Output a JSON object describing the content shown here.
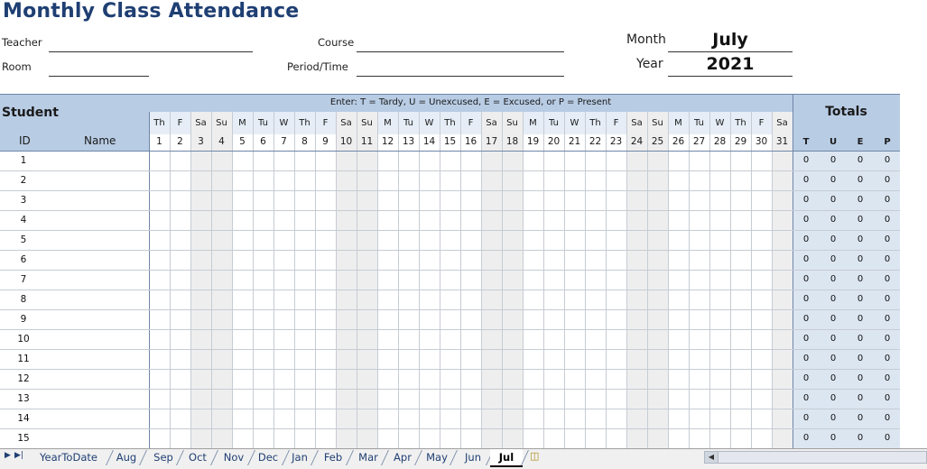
{
  "title": "Monthly Class Attendance",
  "form": {
    "teacher_label": "Teacher",
    "room_label": "Room",
    "course_label": "Course",
    "period_label": "Period/Time",
    "month_label": "Month",
    "month_value": "July",
    "year_label": "Year",
    "year_value": "2021"
  },
  "grid": {
    "student_header": "Student",
    "id_header": "ID",
    "name_header": "Name",
    "instructions": "Enter: T = Tardy,  U = Unexcused,  E = Excused,  or P = Present",
    "totals_header": "Totals",
    "totals_cols": [
      "T",
      "U",
      "E",
      "P"
    ],
    "days": [
      {
        "dow": "Th",
        "date": "1",
        "weekend": false
      },
      {
        "dow": "F",
        "date": "2",
        "weekend": false
      },
      {
        "dow": "Sa",
        "date": "3",
        "weekend": true
      },
      {
        "dow": "Su",
        "date": "4",
        "weekend": true
      },
      {
        "dow": "M",
        "date": "5",
        "weekend": false
      },
      {
        "dow": "Tu",
        "date": "6",
        "weekend": false
      },
      {
        "dow": "W",
        "date": "7",
        "weekend": false
      },
      {
        "dow": "Th",
        "date": "8",
        "weekend": false
      },
      {
        "dow": "F",
        "date": "9",
        "weekend": false
      },
      {
        "dow": "Sa",
        "date": "10",
        "weekend": true
      },
      {
        "dow": "Su",
        "date": "11",
        "weekend": true
      },
      {
        "dow": "M",
        "date": "12",
        "weekend": false
      },
      {
        "dow": "Tu",
        "date": "13",
        "weekend": false
      },
      {
        "dow": "W",
        "date": "14",
        "weekend": false
      },
      {
        "dow": "Th",
        "date": "15",
        "weekend": false
      },
      {
        "dow": "F",
        "date": "16",
        "weekend": false
      },
      {
        "dow": "Sa",
        "date": "17",
        "weekend": true
      },
      {
        "dow": "Su",
        "date": "18",
        "weekend": true
      },
      {
        "dow": "M",
        "date": "19",
        "weekend": false
      },
      {
        "dow": "Tu",
        "date": "20",
        "weekend": false
      },
      {
        "dow": "W",
        "date": "21",
        "weekend": false
      },
      {
        "dow": "Th",
        "date": "22",
        "weekend": false
      },
      {
        "dow": "F",
        "date": "23",
        "weekend": false
      },
      {
        "dow": "Sa",
        "date": "24",
        "weekend": true
      },
      {
        "dow": "Su",
        "date": "25",
        "weekend": true
      },
      {
        "dow": "M",
        "date": "26",
        "weekend": false
      },
      {
        "dow": "Tu",
        "date": "27",
        "weekend": false
      },
      {
        "dow": "W",
        "date": "28",
        "weekend": false
      },
      {
        "dow": "Th",
        "date": "29",
        "weekend": false
      },
      {
        "dow": "F",
        "date": "30",
        "weekend": false
      },
      {
        "dow": "Sa",
        "date": "31",
        "weekend": true
      }
    ],
    "rows": [
      {
        "id": "1",
        "totals": [
          "0",
          "0",
          "0",
          "0"
        ]
      },
      {
        "id": "2",
        "totals": [
          "0",
          "0",
          "0",
          "0"
        ]
      },
      {
        "id": "3",
        "totals": [
          "0",
          "0",
          "0",
          "0"
        ]
      },
      {
        "id": "4",
        "totals": [
          "0",
          "0",
          "0",
          "0"
        ]
      },
      {
        "id": "5",
        "totals": [
          "0",
          "0",
          "0",
          "0"
        ]
      },
      {
        "id": "6",
        "totals": [
          "0",
          "0",
          "0",
          "0"
        ]
      },
      {
        "id": "7",
        "totals": [
          "0",
          "0",
          "0",
          "0"
        ]
      },
      {
        "id": "8",
        "totals": [
          "0",
          "0",
          "0",
          "0"
        ]
      },
      {
        "id": "9",
        "totals": [
          "0",
          "0",
          "0",
          "0"
        ]
      },
      {
        "id": "10",
        "totals": [
          "0",
          "0",
          "0",
          "0"
        ]
      },
      {
        "id": "11",
        "totals": [
          "0",
          "0",
          "0",
          "0"
        ]
      },
      {
        "id": "12",
        "totals": [
          "0",
          "0",
          "0",
          "0"
        ]
      },
      {
        "id": "13",
        "totals": [
          "0",
          "0",
          "0",
          "0"
        ]
      },
      {
        "id": "14",
        "totals": [
          "0",
          "0",
          "0",
          "0"
        ]
      },
      {
        "id": "15",
        "totals": [
          "0",
          "0",
          "0",
          "0"
        ]
      }
    ]
  },
  "tabs": {
    "items": [
      "YearToDate",
      "Aug",
      "Sep",
      "Oct",
      "Nov",
      "Dec",
      "Jan",
      "Feb",
      "Mar",
      "Apr",
      "May",
      "Jun",
      "Jul"
    ],
    "active": "Jul"
  },
  "icons": {
    "nav_last": "navigate-last-sheet-icon",
    "nav_next": "navigate-next-sheet-icon",
    "new_sheet": "insert-sheet-icon"
  },
  "colors": {
    "title": "#1f3f73",
    "header": "#b8cce4",
    "totals_column": "#dce6f1",
    "weekend": "#eeeeee"
  }
}
